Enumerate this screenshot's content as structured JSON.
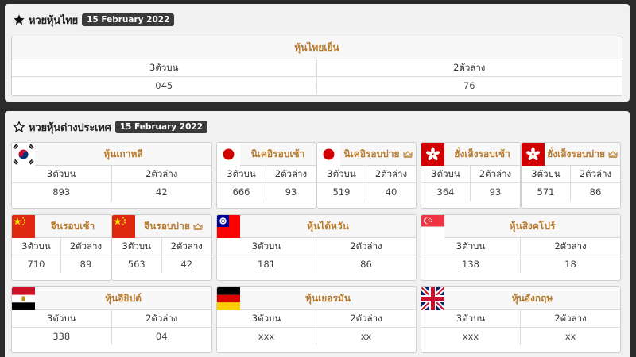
{
  "thai": {
    "title": "หวยหุ้นไทย",
    "date": "15 February 2022",
    "card": {
      "name": "หุ้นไทยเย็น",
      "top3_label": "3ตัวบน",
      "bottom2_label": "2ตัวล่าง",
      "top3": "045",
      "bottom2": "76"
    }
  },
  "foreign": {
    "title": "หวยหุ้นต่างประเทศ",
    "date": "15 February 2022",
    "cards": [
      {
        "name": "หุ้นเกาหลี",
        "flag": "korea",
        "top3_label": "3ตัวบน",
        "bottom2_label": "2ตัวล่าง",
        "top3": "893",
        "bottom2": "42"
      },
      {
        "name": "นิเคอิรอบเช้า",
        "flag": "japan",
        "top3_label": "3ตัวบน",
        "bottom2_label": "2ตัวล่าง",
        "top3": "666",
        "bottom2": "93"
      },
      {
        "name": "นิเคอิรอบบ่าย",
        "flag": "japan",
        "top3_label": "3ตัวบน",
        "bottom2_label": "2ตัวล่าง",
        "top3": "519",
        "bottom2": "40"
      },
      {
        "name": "ฮั่งเส็งรอบเช้า",
        "flag": "hongkong",
        "top3_label": "3ตัวบน",
        "bottom2_label": "2ตัวล่าง",
        "top3": "364",
        "bottom2": "93"
      },
      {
        "name": "ฮั่งเส็งรอบบ่าย",
        "flag": "hongkong",
        "top3_label": "3ตัวบน",
        "bottom2_label": "2ตัวล่าง",
        "top3": "571",
        "bottom2": "86"
      },
      {
        "name": "จีนรอบเช้า",
        "flag": "china",
        "top3_label": "3ตัวบน",
        "bottom2_label": "2ตัวล่าง",
        "top3": "710",
        "bottom2": "89"
      },
      {
        "name": "จีนรอบบ่าย",
        "flag": "china",
        "top3_label": "3ตัวบน",
        "bottom2_label": "2ตัวล่าง",
        "top3": "563",
        "bottom2": "42"
      },
      {
        "name": "หุ้นไต้หวัน",
        "flag": "taiwan",
        "top3_label": "3ตัวบน",
        "bottom2_label": "2ตัวล่าง",
        "top3": "181",
        "bottom2": "86"
      },
      {
        "name": "หุ้นสิงคโปร์",
        "flag": "singapore",
        "top3_label": "3ตัวบน",
        "bottom2_label": "2ตัวล่าง",
        "top3": "138",
        "bottom2": "18"
      },
      {
        "name": "หุ้นอียิปต์",
        "flag": "egypt",
        "top3_label": "3ตัวบน",
        "bottom2_label": "2ตัวล่าง",
        "top3": "338",
        "bottom2": "04"
      },
      {
        "name": "หุ้นเยอรมัน",
        "flag": "germany",
        "top3_label": "3ตัวบน",
        "bottom2_label": "2ตัวล่าง",
        "top3": "xxx",
        "bottom2": "xx"
      },
      {
        "name": "หุ้นอังกฤษ",
        "flag": "uk",
        "top3_label": "3ตัวบน",
        "bottom2_label": "2ตัวล่าง",
        "top3": "xxx",
        "bottom2": "xx"
      }
    ]
  },
  "colors": {
    "accent": "#b87a2c",
    "badge": "#3a3a3a",
    "panel": "#f1f1f1",
    "background": "#2b2b2b"
  }
}
